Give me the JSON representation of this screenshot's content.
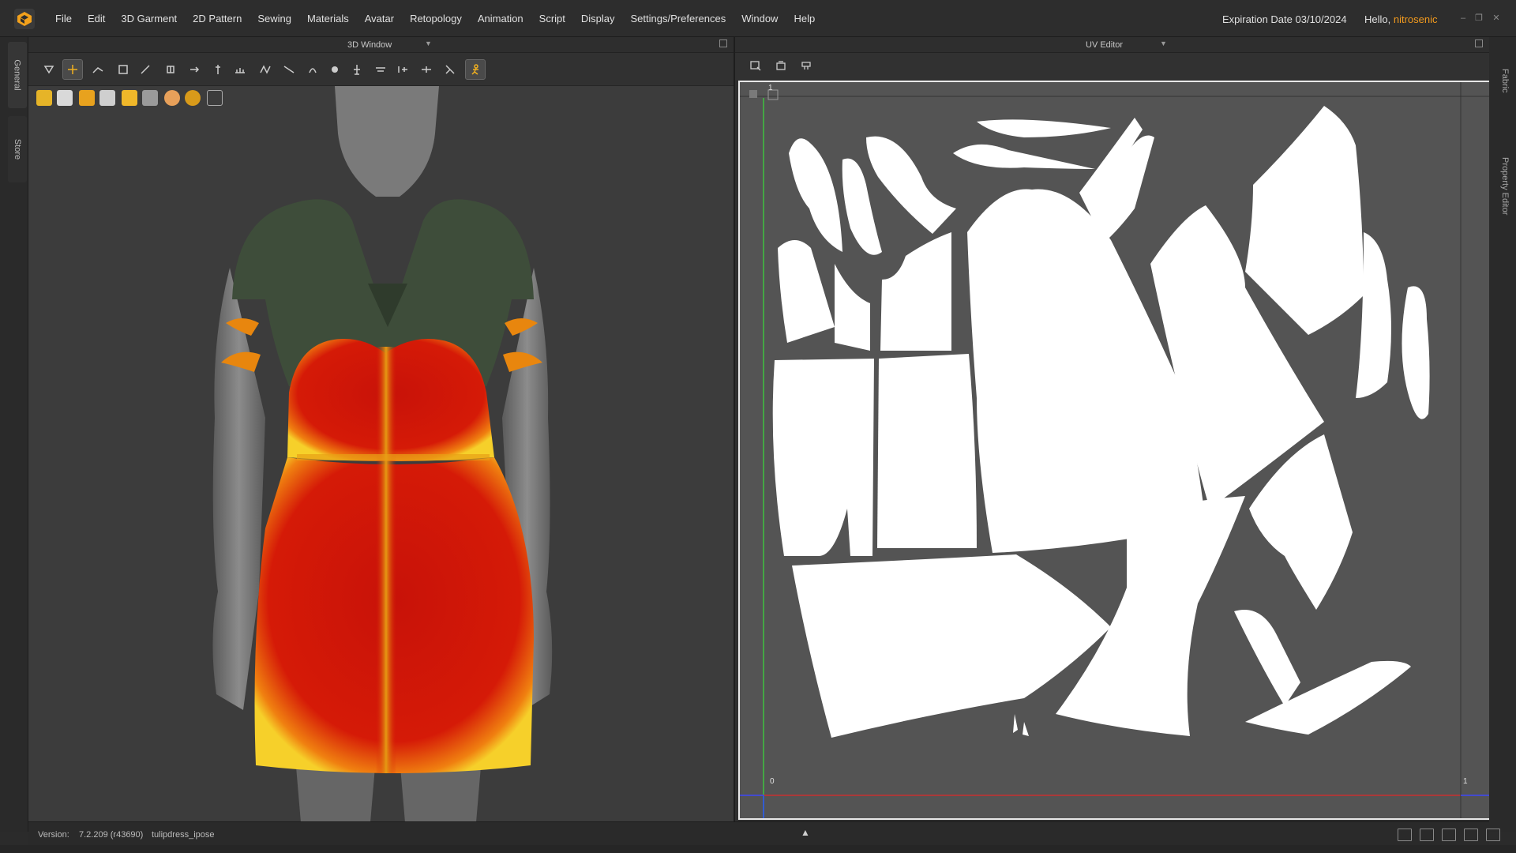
{
  "menubar": {
    "items": [
      "File",
      "Edit",
      "3D Garment",
      "2D Pattern",
      "Sewing",
      "Materials",
      "Avatar",
      "Retopology",
      "Animation",
      "Script",
      "Display",
      "Settings/Preferences",
      "Window",
      "Help"
    ],
    "expiration": "Expiration Date 03/10/2024",
    "hello_prefix": "Hello, ",
    "username": "nitrosenic"
  },
  "left_tabs": [
    "General",
    "Store"
  ],
  "right_tabs": [
    "Fabric",
    "Property Editor"
  ],
  "window3d": {
    "title": "3D Window",
    "toolbar_icons": [
      "select-move-icon",
      "transform-icon",
      "edit-icon",
      "fold-icon",
      "pin-icon",
      "tack-icon",
      "arrange-icon",
      "shape-icon",
      "measure-icon",
      "steam-icon",
      "seamline-icon",
      "drape-icon",
      "punch-icon",
      "trim-icon",
      "topstitch-icon",
      "buttons-icon",
      "cut-icon",
      "simulation-icon"
    ],
    "toolbar2_icons": [
      "avatar-icon",
      "garment-icon",
      "texture-icon",
      "pose-icon",
      "material-icon",
      "strain-icon",
      "skin-icon",
      "globe-icon",
      "export-icon"
    ]
  },
  "uv_editor": {
    "title": "UV Editor",
    "toolbar_icons": [
      "uv-select-icon",
      "uv-pack-icon",
      "uv-arrange-icon"
    ],
    "axis_origin": "0",
    "axis_x_end": "1",
    "axis_y_end": "1"
  },
  "statusbar": {
    "version_label": "Version:",
    "version": "7.2.209 (r43690)",
    "filename": "tulipdress_ipose"
  },
  "colors": {
    "accent": "#f29a1e",
    "dress_red": "#d81e0a",
    "dress_green": "#3e4d3a",
    "uv_bg": "#545454"
  }
}
